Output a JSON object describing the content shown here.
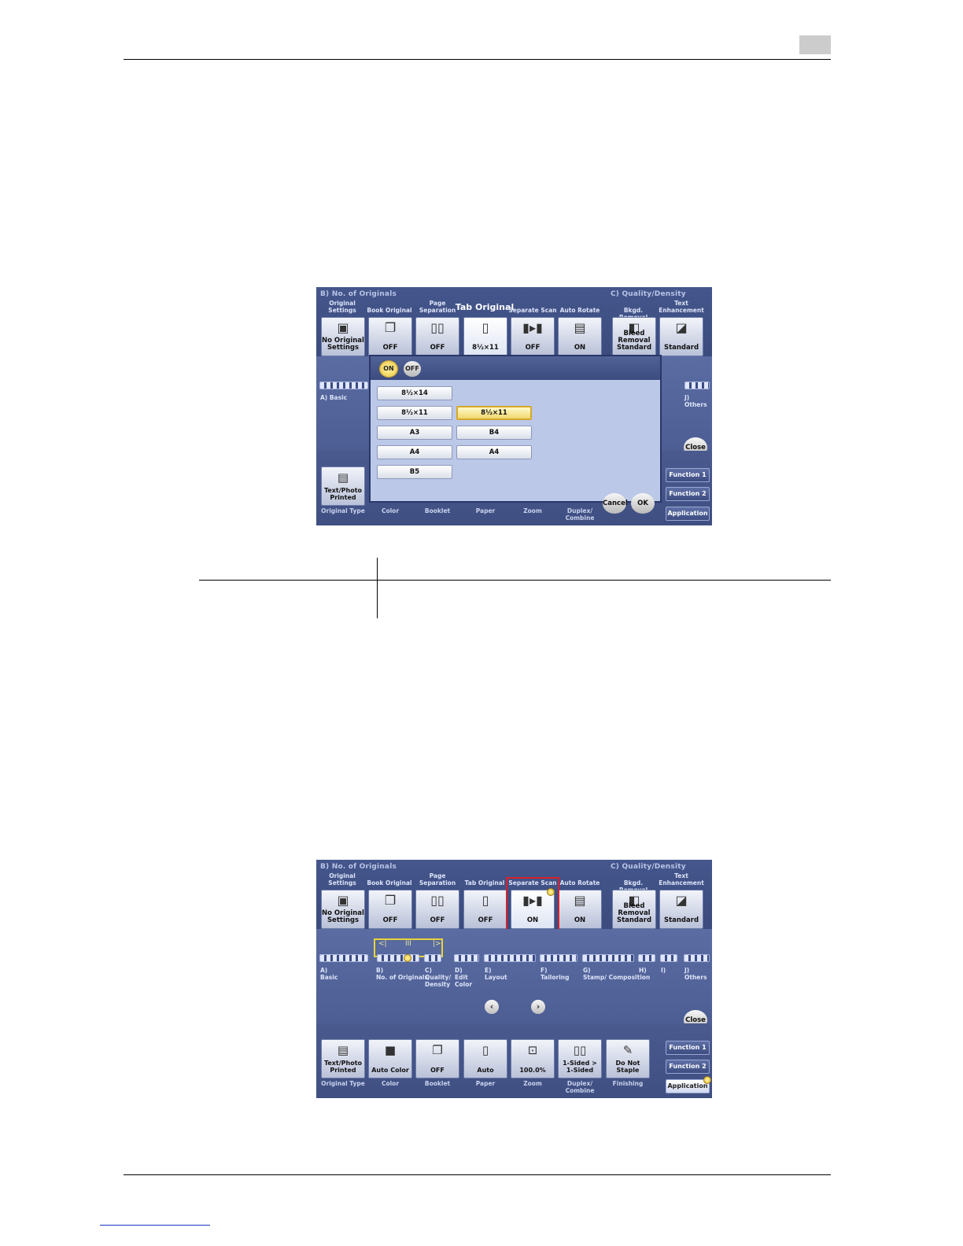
{
  "page": {
    "header_tab_color": "#cccccc",
    "footer_link_color": "#1a37c9"
  },
  "shot1": {
    "section_b": "B)   No. of Originals",
    "section_c": "C)   Quality/Density",
    "tabs": [
      {
        "label": "Original Settings",
        "value": "No Original Settings",
        "icon": "original-settings-icon"
      },
      {
        "label": "Book Original",
        "value": "OFF",
        "icon": "book-icon"
      },
      {
        "label": "Page Separation",
        "value": "OFF",
        "icon": "page-separation-icon"
      },
      {
        "label": "Tab Original",
        "value": "8½×11",
        "icon": "tab-original-icon"
      },
      {
        "label": "Separate Scan",
        "value": "OFF",
        "icon": "separate-scan-icon"
      },
      {
        "label": "Auto Rotate",
        "value": "ON",
        "icon": "auto-rotate-icon"
      },
      {
        "label": "Bkgd. Removal",
        "value": "Bleed Removal Standard",
        "icon": "bkgd-removal-icon"
      },
      {
        "label": "Text Enhancement",
        "value": "Standard",
        "icon": "text-enhancement-icon"
      }
    ],
    "dialog": {
      "on": "ON",
      "off": "OFF",
      "papers_left": [
        "8½×14",
        "8½×11",
        "A3",
        "A4",
        "B5"
      ],
      "papers_right": [
        "8½×11",
        "B4",
        "A4"
      ],
      "cancel": "Cancel",
      "ok": "OK"
    },
    "basic_label": "A) Basic",
    "others_label": "J) Others",
    "close": "Close",
    "function1": "Function 1",
    "function2": "Function 2",
    "application": "Application",
    "bottom": {
      "orig_type_value": "Text/Photo Printed",
      "labels": [
        "Original Type",
        "Color",
        "Booklet",
        "Paper",
        "Zoom",
        "Duplex/ Combine"
      ]
    }
  },
  "table": {
    "header_left": "",
    "header_right": "",
    "row_left": "",
    "row_right": ""
  },
  "shot2": {
    "section_b": "B)   No. of Originals",
    "section_c": "C)   Quality/Density",
    "tabs": [
      {
        "label": "Original Settings",
        "value": "No Original Settings",
        "icon": "original-settings-icon"
      },
      {
        "label": "Book Original",
        "value": "OFF",
        "icon": "book-icon"
      },
      {
        "label": "Page Separation",
        "value": "OFF",
        "icon": "page-separation-icon"
      },
      {
        "label": "Tab Original",
        "value": "OFF",
        "icon": "tab-original-icon"
      },
      {
        "label": "Separate Scan",
        "value": "ON",
        "icon": "separate-scan-icon"
      },
      {
        "label": "Auto Rotate",
        "value": "ON",
        "icon": "auto-rotate-icon"
      },
      {
        "label": "Bkgd. Removal",
        "value": "Bleed Removal Standard",
        "icon": "bkgd-removal-icon"
      },
      {
        "label": "Text Enhancement",
        "value": "Standard",
        "icon": "text-enhancement-icon"
      }
    ],
    "categories": [
      {
        "letter": "A)",
        "name": "Basic"
      },
      {
        "letter": "B)",
        "name": "No. of Originals"
      },
      {
        "letter": "C)",
        "name": "Quality/ Density"
      },
      {
        "letter": "D)",
        "name": "Edit Color"
      },
      {
        "letter": "E)",
        "name": "Layout"
      },
      {
        "letter": "F)",
        "name": "Tailoring"
      },
      {
        "letter": "G)",
        "name": "Stamp/ Composition"
      },
      {
        "letter": "H)",
        "name": ""
      },
      {
        "letter": "I)",
        "name": ""
      },
      {
        "letter": "J)",
        "name": "Others"
      }
    ],
    "close": "Close",
    "function1": "Function 1",
    "function2": "Function 2",
    "application": "Application",
    "bottom": [
      {
        "value": "Text/Photo Printed",
        "label": "Original Type"
      },
      {
        "value": "Auto Color",
        "label": "Color"
      },
      {
        "value": "OFF",
        "label": "Booklet"
      },
      {
        "value": "Auto",
        "label": "Paper"
      },
      {
        "value": "100.0%",
        "label": "Zoom"
      },
      {
        "value": "1-Sided > 1-Sided",
        "label": "Duplex/ Combine"
      },
      {
        "value": "Do Not Staple",
        "label": "Finishing"
      }
    ]
  }
}
